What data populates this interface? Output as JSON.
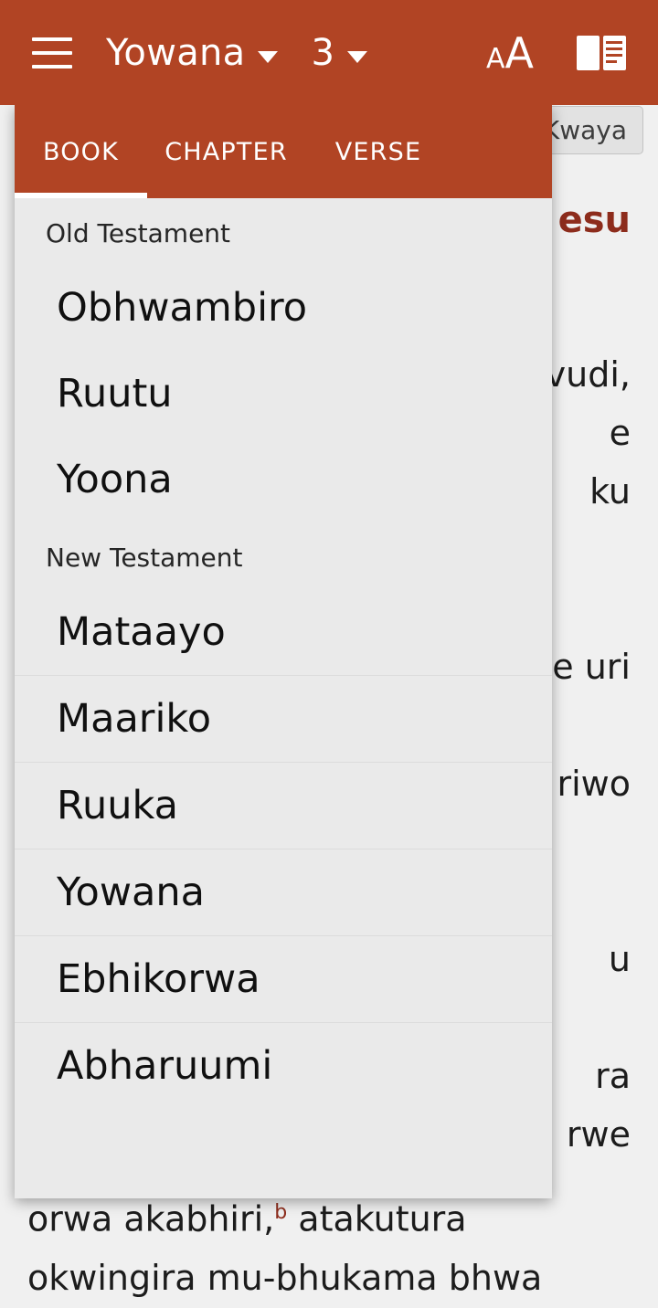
{
  "appbar": {
    "menu_icon": "hamburger-icon",
    "book_label": "Yowana",
    "chapter_label": "3",
    "font_size_icon_small": "A",
    "font_size_icon_big": "A",
    "reader_icon": "open-book-icon"
  },
  "background": {
    "chip_label": "Kwaya",
    "heading": "esu",
    "body": "vudi,\ne\nku\n\n\ne uri\n\nriwo\n\n\nu\n\nra\nrwe",
    "tail_prefix": "orwa akabhiri,",
    "tail_marker": "b",
    "tail_rest": " atakutura",
    "tail_line2": "okwingira mu-bhukama bhwa"
  },
  "dropdown": {
    "tabs": [
      {
        "label": "BOOK",
        "active": true
      },
      {
        "label": "CHAPTER",
        "active": false
      },
      {
        "label": "VERSE",
        "active": false
      }
    ],
    "sections": [
      {
        "label": "Old Testament",
        "items": [
          "Obhwambiro",
          "Ruutu",
          "Yoona"
        ]
      },
      {
        "label": "New Testament",
        "items": [
          "Mataayo",
          "Maariko",
          "Ruuka",
          "Yowana",
          "Ebhikorwa",
          "Abharuumi"
        ]
      }
    ]
  },
  "colors": {
    "accent": "#b14424",
    "heading": "#8d2c1c",
    "panel": "#eaeaea",
    "page": "#f0f0f0"
  }
}
